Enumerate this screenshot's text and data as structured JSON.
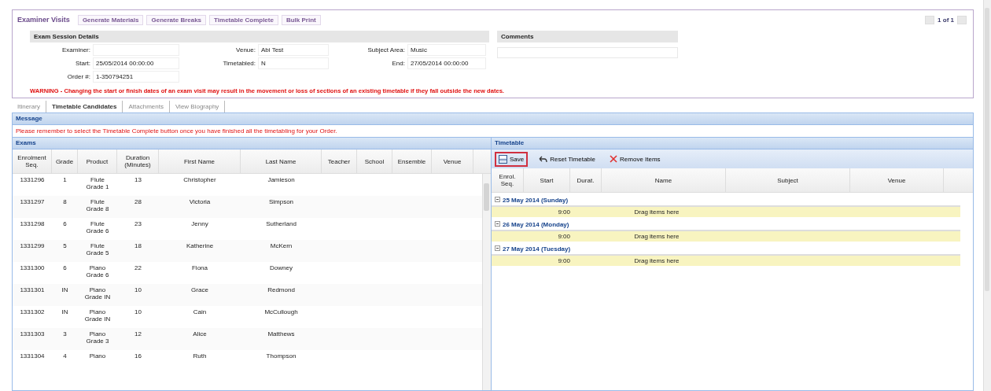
{
  "header": {
    "title": "Examiner Visits",
    "buttons": [
      "Generate Materials",
      "Generate Breaks",
      "Timetable Complete",
      "Bulk Print"
    ],
    "pager": "1 of 1"
  },
  "session": {
    "title": "Exam Session Details",
    "fields": [
      {
        "label": "Examiner:"
      },
      {
        "label": "Venue:",
        "value": "Abi Test"
      },
      {
        "label": "Subject Area:",
        "value": "Music"
      },
      {
        "label": "Start:",
        "value": "25/05/2014 00:00:00"
      },
      {
        "label": "Timetabled:",
        "value": "N"
      },
      {
        "label": "End:",
        "value": "27/05/2014 00:00:00"
      },
      {
        "label": "Order #:",
        "value": "1-350794251"
      }
    ],
    "comments_title": "Comments"
  },
  "warning": "WARNING - Changing the start or finish dates of an exam visit may result in the movement or loss of sections of an existing timetable if they fall outside the new dates.",
  "tabs": [
    {
      "label": "Itinerary",
      "selected": false
    },
    {
      "label": "Timetable Candidates",
      "selected": true
    },
    {
      "label": "Attachments",
      "selected": false
    },
    {
      "label": "View Biography",
      "selected": false
    }
  ],
  "message": {
    "title": "Message",
    "text": "Please remember to select the Timetable Complete button once you have finished all the timetabling for your Order."
  },
  "exams": {
    "title": "Exams",
    "columns": [
      "Enrolment Seq.",
      "Grade",
      "Product",
      "Duration (Minutes)",
      "First Name",
      "Last Name",
      "Teacher",
      "School",
      "Ensemble",
      "Venue"
    ],
    "rows": [
      [
        "1331296",
        "1",
        "Flute Grade 1",
        "13",
        "Christopher",
        "Jamieson"
      ],
      [
        "1331297",
        "8",
        "Flute Grade 8",
        "28",
        "Victoria",
        "Simpson"
      ],
      [
        "1331298",
        "6",
        "Flute Grade 6",
        "23",
        "Jenny",
        "Sutherland"
      ],
      [
        "1331299",
        "5",
        "Flute Grade 5",
        "18",
        "Katherine",
        "McKern"
      ],
      [
        "1331300",
        "6",
        "Piano Grade 6",
        "22",
        "Fiona",
        "Downey"
      ],
      [
        "1331301",
        "IN",
        "Piano Grade IN",
        "10",
        "Grace",
        "Redmond"
      ],
      [
        "1331302",
        "IN",
        "Piano Grade IN",
        "10",
        "Cain",
        "McCullough"
      ],
      [
        "1331303",
        "3",
        "Piano Grade 3",
        "12",
        "Alice",
        "Matthews"
      ],
      [
        "1331304",
        "4",
        "Piano",
        "16",
        "Ruth",
        "Thompson"
      ]
    ]
  },
  "timetable": {
    "title": "Timetable",
    "toolbar": [
      {
        "kind": "save",
        "label": "Save",
        "focused": true
      },
      {
        "kind": "reset",
        "label": "Reset Timetable",
        "focused": false
      },
      {
        "kind": "remove",
        "label": "Remove Items",
        "focused": false
      }
    ],
    "columns": [
      "Enrol. Seq.",
      "Start",
      "Durat.",
      "Name",
      "Subject",
      "Venue"
    ],
    "groups": [
      {
        "date": "25 May 2014 (Sunday)",
        "rows": [
          {
            "start": "9:00",
            "name": "Drag items here"
          }
        ]
      },
      {
        "date": "26 May 2014 (Monday)",
        "rows": [
          {
            "start": "9:00",
            "name": "Drag items here"
          }
        ]
      },
      {
        "date": "27 May 2014 (Tuesday)",
        "rows": [
          {
            "start": "9:00",
            "name": "Drag items here"
          }
        ]
      }
    ]
  }
}
